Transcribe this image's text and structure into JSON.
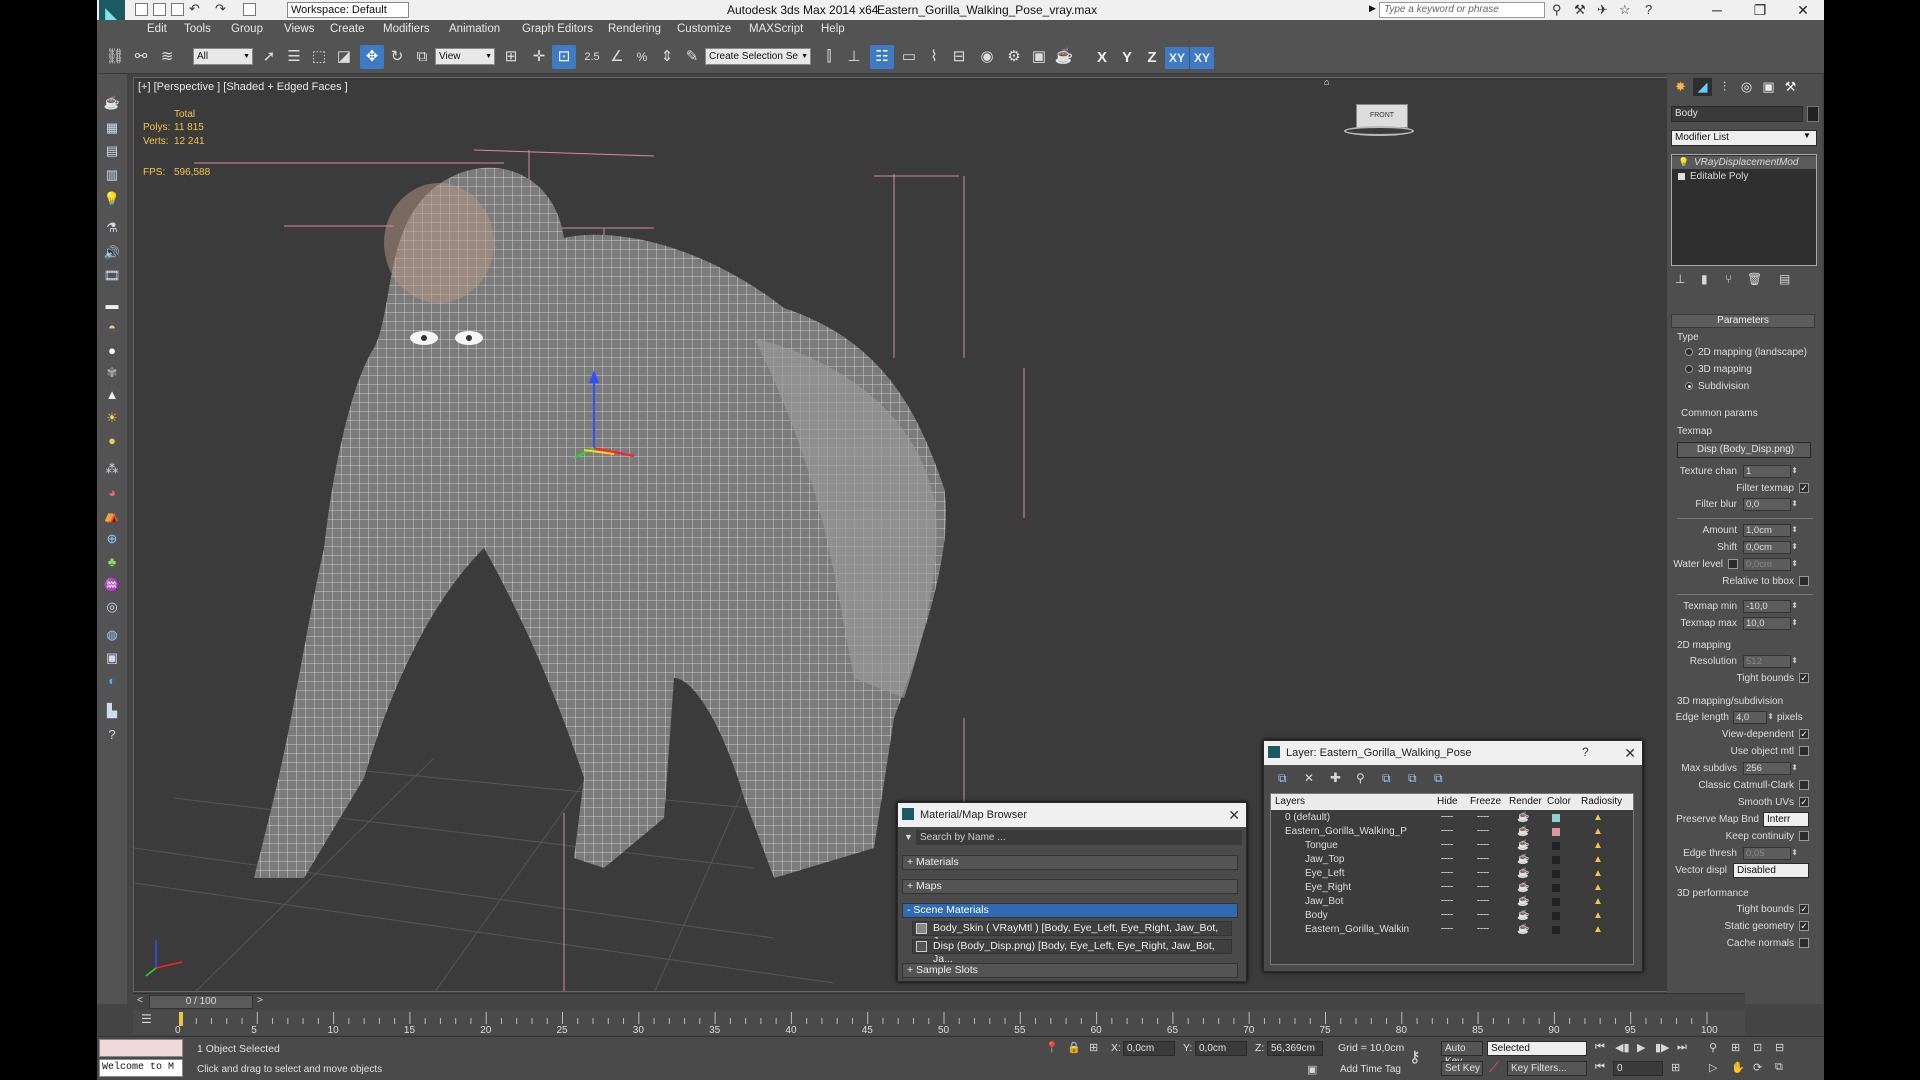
{
  "window": {
    "app_title": "Autodesk 3ds Max  2014 x64",
    "file": "Eastern_Gorilla_Walking_Pose_vray.max",
    "workspace": "Workspace: Default",
    "help_search_placeholder": "Type a keyword or phrase",
    "min": "─",
    "max": "❐",
    "close": "✕"
  },
  "menu": [
    "Edit",
    "Tools",
    "Group",
    "Views",
    "Create",
    "Modifiers",
    "Animation",
    "Graph Editors",
    "Rendering",
    "Customize",
    "MAXScript",
    "Help"
  ],
  "toolbar": {
    "filter": "All",
    "ref_coord": "View",
    "snap_label": "2.5",
    "selection_set": "Create Selection Se",
    "axes": [
      "X",
      "Y",
      "Z",
      "XY",
      "XY"
    ]
  },
  "viewport": {
    "label": "[+] [Perspective ] [Shaded + Edged Faces ]",
    "stats_total": "Total",
    "polys_label": "Polys:",
    "polys_value": "11 815",
    "verts_label": "Verts:",
    "verts_value": "12 241",
    "fps_label": "FPS:",
    "fps_value": "596,588",
    "viewcube": "FRONT"
  },
  "command_panel": {
    "object_name": "Body",
    "modifier_list": "Modifier List",
    "stack": [
      "VRayDisplacementMod",
      "Editable Poly"
    ],
    "rollout_title": "Parameters",
    "type_group": "Type",
    "type_options": [
      "2D mapping (landscape)",
      "3D mapping",
      "Subdivision"
    ],
    "common_params": "Common params",
    "texmap_label": "Texmap",
    "texmap_value": "Disp (Body_Disp.png)",
    "texture_chan_label": "Texture chan",
    "texture_chan": "1",
    "filter_texmap": "Filter texmap",
    "filter_blur_label": "Filter blur",
    "filter_blur": "0,0",
    "amount_label": "Amount",
    "amount": "1,0cm",
    "shift_label": "Shift",
    "shift": "0,0cm",
    "water_level_label": "Water level",
    "water_level": "0,0cm",
    "relative_bbox": "Relative to bbox",
    "texmap_min_label": "Texmap min",
    "texmap_min": "-10,0",
    "texmap_max_label": "Texmap max",
    "texmap_max": "10,0",
    "mapping2d_group": "2D mapping",
    "resolution_label": "Resolution",
    "resolution": "512",
    "tight_bounds": "Tight bounds",
    "mapping3d_group": "3D mapping/subdivision",
    "edge_length_label": "Edge length",
    "edge_length": "4,0",
    "pixels": "pixels",
    "view_dependent": "View-dependent",
    "use_object_mtl": "Use object mtl",
    "max_subdivs_label": "Max subdivs",
    "max_subdivs": "256",
    "classic_catmull": "Classic Catmull-Clark",
    "smooth_uvs": "Smooth UVs",
    "preserve_map_label": "Preserve Map Bnd",
    "preserve_map": "Interr",
    "keep_continuity": "Keep continuity",
    "edge_thresh_label": "Edge thresh",
    "edge_thresh": "0,05",
    "vector_displ_label": "Vector displ",
    "vector_displ": "Disabled",
    "perf_group": "3D performance",
    "perf_tight_bounds": "Tight bounds",
    "static_geometry": "Static geometry",
    "cache_normals": "Cache normals"
  },
  "material_browser": {
    "title": "Material/Map Browser",
    "search_placeholder": "Search by Name ...",
    "sections": [
      "+ Materials",
      "+ Maps",
      "- Scene Materials"
    ],
    "items": [
      "Body_Skin  ( VRayMtl ) [Body, Eye_Left, Eye_Right, Jaw_Bot, J...",
      "Disp (Body_Disp.png) [Body, Eye_Left, Eye_Right, Jaw_Bot, Ja..."
    ],
    "sample_slots": "+ Sample Slots"
  },
  "layer_window": {
    "title": "Layer: Eastern_Gorilla_Walking_Pose",
    "help": "?",
    "columns": [
      "Layers",
      "Hide",
      "Freeze",
      "Render",
      "Color",
      "Radiosity"
    ],
    "rows": [
      {
        "name": "0 (default)",
        "color": "#8fd0d0"
      },
      {
        "name": "Eastern_Gorilla_Walking_P",
        "color": "#d89a9a"
      },
      {
        "name": "Tongue",
        "color": "#222222"
      },
      {
        "name": "Jaw_Top",
        "color": "#222222"
      },
      {
        "name": "Eye_Left",
        "color": "#222222"
      },
      {
        "name": "Eye_Right",
        "color": "#222222"
      },
      {
        "name": "Jaw_Bot",
        "color": "#222222"
      },
      {
        "name": "Body",
        "color": "#222222"
      },
      {
        "name": "Eastern_Gorilla_Walkin",
        "color": "#222222"
      }
    ]
  },
  "timeline": {
    "frame": "0 / 100",
    "ticks": [
      "0",
      "5",
      "10",
      "15",
      "20",
      "25",
      "30",
      "35",
      "40",
      "45",
      "50",
      "55",
      "60",
      "65",
      "70",
      "75",
      "80",
      "85",
      "90",
      "95",
      "100"
    ]
  },
  "status": {
    "maxscript": "Welcome to M",
    "selected": "1 Object Selected",
    "prompt": "Click and drag to select and move objects",
    "x_label": "X:",
    "x": "0,0cm",
    "y_label": "Y:",
    "y": "0,0cm",
    "z_label": "Z:",
    "z": "56,369cm",
    "grid": "Grid = 10,0cm",
    "add_time_tag": "Add Time Tag",
    "auto_key": "Auto Key",
    "key_mode": "Selected",
    "set_key": "Set Key",
    "key_filters": "Key Filters...",
    "current_frame": "0"
  }
}
